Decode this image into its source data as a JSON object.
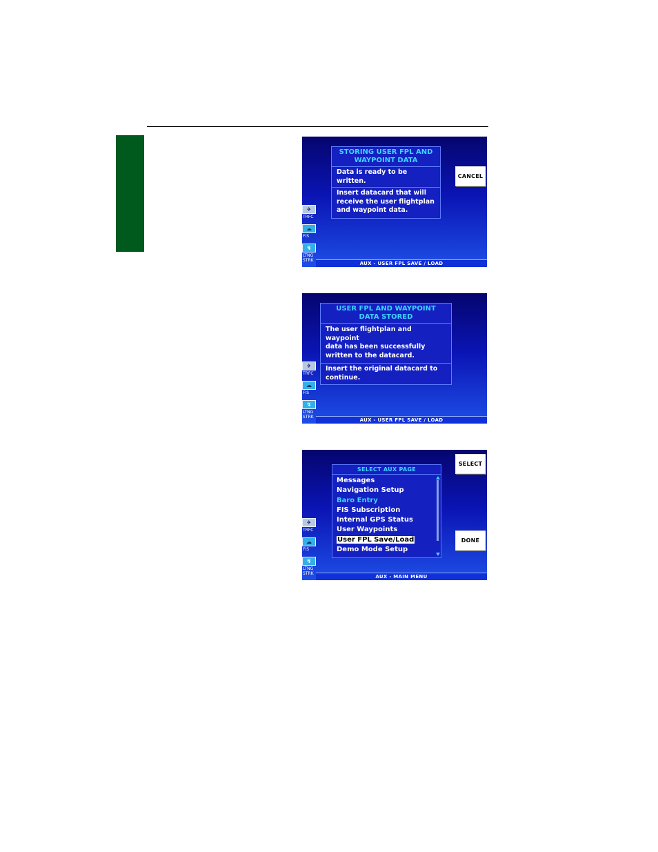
{
  "page": {},
  "sidebar": {
    "traffic_label": "TRFC",
    "fis_label": "FIS",
    "lightning_label_1": "LTNG",
    "lightning_label_2": "STRK"
  },
  "screen1": {
    "title_line1": "STORING USER FPL AND",
    "title_line2": "WAYPOINT DATA",
    "line_ready": "Data is ready to be written.",
    "insert_line1": "Insert datacard that will",
    "insert_line2": "receive the user flightplan",
    "insert_line3": "and waypoint data.",
    "cancel_label": "CANCEL",
    "status": "AUX - USER FPL SAVE / LOAD"
  },
  "screen2": {
    "title_line1": "USER FPL AND WAYPOINT",
    "title_line2": "DATA STORED",
    "msg_line1": "The user flightplan and waypoint",
    "msg_line2": "data has been successfully",
    "msg_line3": "written to the datacard.",
    "insert_line1": "Insert the original datacard to",
    "insert_line2": "continue.",
    "status": "AUX - USER FPL SAVE / LOAD"
  },
  "screen3": {
    "menu_title": "SELECT AUX PAGE",
    "items": [
      "Messages",
      "Navigation Setup",
      "Baro Entry",
      "FIS Subscription",
      "Internal GPS Status",
      "User Waypoints",
      "User FPL Save/Load",
      "Demo Mode Setup"
    ],
    "selected_item": "User FPL Save/Load",
    "select_label": "SELECT",
    "done_label": "DONE",
    "status": "AUX - MAIN MENU"
  },
  "icons": {
    "traffic": "traffic-icon",
    "fis": "fis-icon",
    "lightning": "lightning-icon",
    "scroll_up": "scroll-up-icon",
    "scroll_down": "scroll-down-icon"
  },
  "colors": {
    "section_tab": "#005a1e",
    "screen_top": "#05056e",
    "screen_bottom": "#1e4ee6",
    "title_cyan": "#3cd4ff"
  }
}
